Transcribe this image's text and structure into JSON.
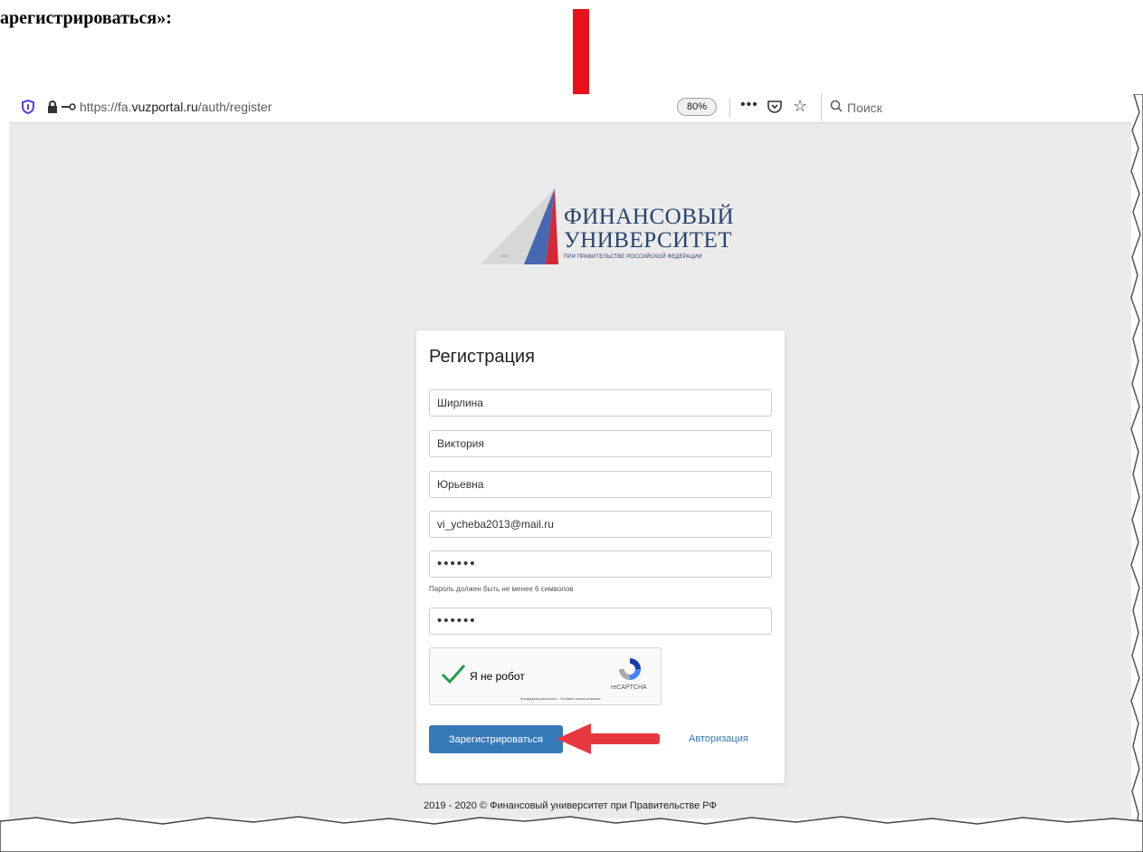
{
  "doc": {
    "heading": "арегистрироваться»:"
  },
  "browser": {
    "url_prefix": "https://fa.",
    "url_domain": "vuzportal.ru",
    "url_path": "/auth/register",
    "zoom": "80%",
    "search_placeholder": "Поиск"
  },
  "logo": {
    "line1": "ФИНАНСОВЫЙ",
    "line2": "УНИВЕРСИТЕТ",
    "line3": "ПРИ ПРАВИТЕЛЬСТВЕ РОССИЙСКОЙ ФЕДЕРАЦИИ",
    "tag": "1919"
  },
  "form": {
    "title": "Регистрация",
    "last_name": "Ширлина",
    "first_name": "Виктория",
    "middle_name": "Юрьевна",
    "email": "vi_ycheba2013@mail.ru",
    "password": "••••••",
    "password_hint": "Пароль должен быть не менее 6 символов",
    "password_confirm": "••••••",
    "captcha_label": "Я не робот",
    "captcha_brand": "reCAPTCHA",
    "captcha_links": "Конфиденциальность - Условия использования",
    "submit_label": "Зарегистрироваться",
    "auth_link": "Авторизация"
  },
  "footer": {
    "text": "2019 - 2020 © Финансовый университет при Правительстве РФ"
  },
  "colors": {
    "accent": "#3579b8",
    "arrow": "#e8101a",
    "page_bg": "#ebebeb"
  }
}
